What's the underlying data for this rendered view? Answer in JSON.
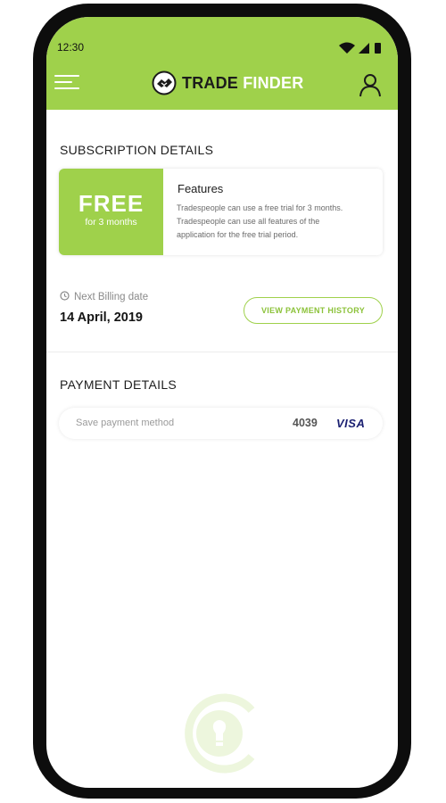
{
  "status_bar": {
    "time": "12:30",
    "icons": [
      "wifi-icon",
      "signal-icon",
      "battery-icon"
    ]
  },
  "header": {
    "menu_icon": "hamburger-menu-icon",
    "logo_icon": "handshake-logo-icon",
    "logo_word1": "TRADE",
    "logo_word2": "FINDER",
    "profile_icon": "user-profile-icon"
  },
  "subscription": {
    "title": "SUBSCRIPTION DETAILS",
    "plan_name": "FREE",
    "plan_duration": "for 3 months",
    "features_title": "Features",
    "features_lines": [
      "Tradespeople can use a free trial for 3 months.",
      "Tradespeople can use all features of the",
      "application for the free trial period."
    ]
  },
  "billing": {
    "label": "Next Billing date",
    "date": "14 April, 2019",
    "history_button": "VIEW PAYMENT HISTORY"
  },
  "payment": {
    "title": "PAYMENT DETAILS",
    "placeholder": "Save payment method",
    "card_last4": "4039",
    "card_brand": "VISA"
  },
  "colors": {
    "brand_green": "#9fd14b",
    "frame": "#0d0d0d",
    "visa_blue": "#1a1f71"
  }
}
